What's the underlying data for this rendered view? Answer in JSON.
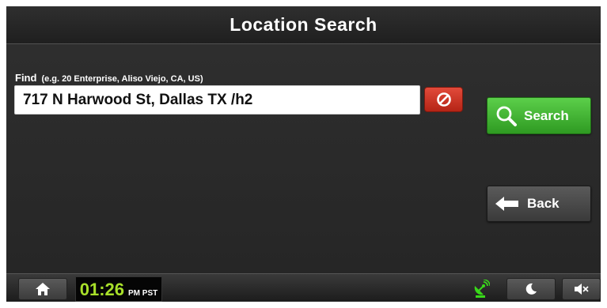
{
  "header": {
    "title": "Location Search"
  },
  "find": {
    "label": "Find",
    "hint": "(e.g. 20 Enterprise, Aliso Viejo, CA, US)",
    "value": "717 N Harwood St, Dallas TX /h2"
  },
  "buttons": {
    "search_label": "Search",
    "back_label": "Back"
  },
  "statusbar": {
    "time": "01:26",
    "zone": "PM PST"
  },
  "icons": {
    "clear": "no-entry-icon",
    "search": "magnifier-icon",
    "back": "left-arrow-icon",
    "home": "home-icon",
    "gps": "gps-satellite-icon",
    "night": "moon-icon",
    "mute": "speaker-mute-icon"
  },
  "colors": {
    "accent_green": "#3fb02c",
    "clear_red": "#d03424",
    "clock_green": "#a8e02a",
    "gps_green": "#39d81a"
  }
}
